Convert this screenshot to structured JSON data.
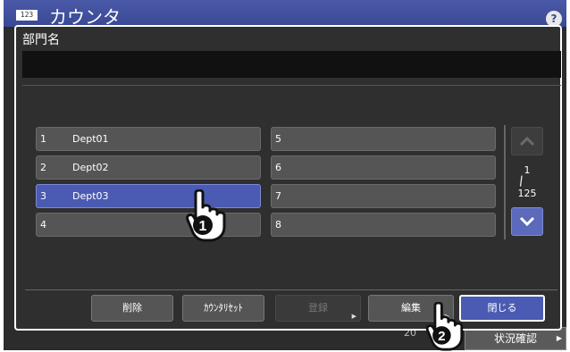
{
  "app": {
    "counter_icon": "123",
    "title": "カウンタ",
    "help": "?",
    "footer_date": "20",
    "status_button": "状況確認"
  },
  "dialog": {
    "title": "部門名",
    "name_value": "",
    "list": [
      {
        "num": "1",
        "name": "Dept01",
        "selected": false
      },
      {
        "num": "2",
        "name": "Dept02",
        "selected": false
      },
      {
        "num": "3",
        "name": "Dept03",
        "selected": true
      },
      {
        "num": "4",
        "name": "",
        "selected": false
      },
      {
        "num": "5",
        "name": "",
        "selected": false
      },
      {
        "num": "6",
        "name": "",
        "selected": false
      },
      {
        "num": "7",
        "name": "",
        "selected": false
      },
      {
        "num": "8",
        "name": "",
        "selected": false
      }
    ],
    "pager": {
      "current": "1",
      "total": "125"
    },
    "buttons": {
      "delete": "削除",
      "counter_reset": "ｶｳﾝﾀﾘｾｯﾄ",
      "register": "登録",
      "edit": "編集",
      "close": "閉じる"
    }
  },
  "callouts": [
    {
      "number": "1",
      "icon": "hand-pointer-icon"
    },
    {
      "number": "2",
      "icon": "hand-pointer-icon"
    }
  ],
  "colors": {
    "header": "#3a4894",
    "selected": "#4b5bb3",
    "dialog_bg": "#2f2f2f"
  }
}
